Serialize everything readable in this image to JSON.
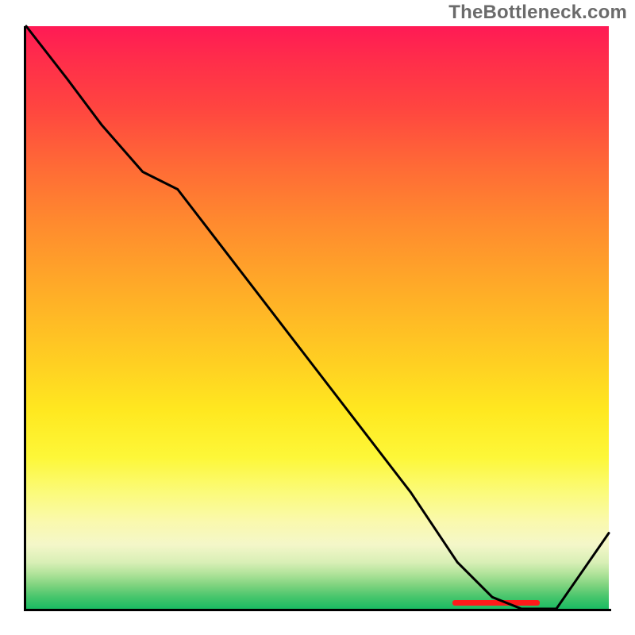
{
  "watermark": "TheBottleneck.com",
  "chart_data": {
    "type": "line",
    "title": "",
    "xlabel": "",
    "ylabel": "",
    "xlim": [
      0,
      100
    ],
    "ylim": [
      0,
      100
    ],
    "series": [
      {
        "name": "curve",
        "x": [
          0,
          7,
          13,
          20,
          26,
          36,
          46,
          56,
          66,
          74,
          80,
          85,
          88,
          91,
          100
        ],
        "values": [
          100,
          91,
          83,
          75,
          72,
          59,
          46,
          33,
          20,
          8,
          2,
          0,
          0,
          0,
          13
        ]
      }
    ],
    "highlight_band": {
      "x_start": 74,
      "x_end": 88,
      "color": "#ff1a1a"
    },
    "gradient_background": {
      "stops": [
        {
          "pos": 0.0,
          "color": "#ff1a55"
        },
        {
          "pos": 0.5,
          "color": "#ffc024"
        },
        {
          "pos": 0.8,
          "color": "#fbfb7a"
        },
        {
          "pos": 1.0,
          "color": "#1abc63"
        }
      ]
    }
  }
}
